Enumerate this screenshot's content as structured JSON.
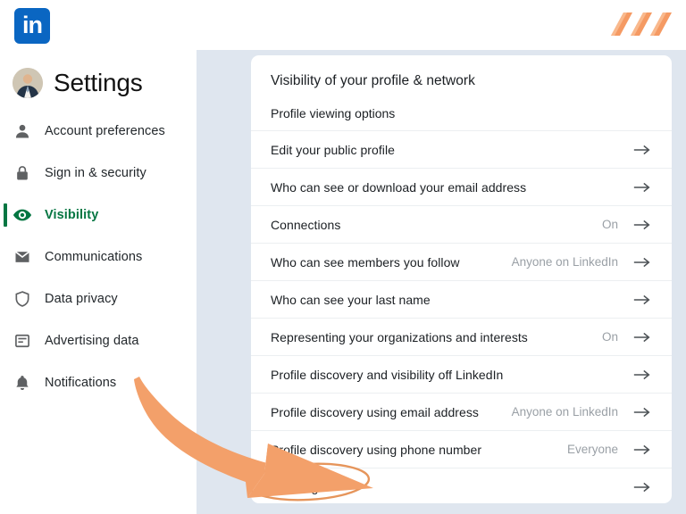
{
  "brand": {
    "logo_text": "in",
    "logo_color": "#0a66c2",
    "accent_color": "#057642",
    "annotation_color": "#f3a06a"
  },
  "sidebar": {
    "title": "Settings",
    "avatar_name": "profile-avatar",
    "items": [
      {
        "label": "Account preferences",
        "icon": "person-icon",
        "active": false
      },
      {
        "label": "Sign in & security",
        "icon": "lock-icon",
        "active": false
      },
      {
        "label": "Visibility",
        "icon": "eye-icon",
        "active": true
      },
      {
        "label": "Communications",
        "icon": "envelope-icon",
        "active": false
      },
      {
        "label": "Data privacy",
        "icon": "shield-icon",
        "active": false
      },
      {
        "label": "Advertising data",
        "icon": "card-icon",
        "active": false
      },
      {
        "label": "Notifications",
        "icon": "bell-icon",
        "active": false
      }
    ]
  },
  "main": {
    "title": "Visibility of your profile & network",
    "section_heading": "Profile viewing options",
    "rows": [
      {
        "label": "Edit your public profile",
        "value": ""
      },
      {
        "label": "Who can see or download your email address",
        "value": ""
      },
      {
        "label": "Connections",
        "value": "On"
      },
      {
        "label": "Who can see members you follow",
        "value": "Anyone on LinkedIn"
      },
      {
        "label": "Who can see your last name",
        "value": ""
      },
      {
        "label": "Representing your organizations and interests",
        "value": "On"
      },
      {
        "label": "Profile discovery and visibility off LinkedIn",
        "value": ""
      },
      {
        "label": "Profile discovery using email address",
        "value": "Anyone on LinkedIn"
      },
      {
        "label": "Profile discovery using phone number",
        "value": "Everyone"
      },
      {
        "label": "Blocking",
        "value": ""
      }
    ]
  },
  "annotation": {
    "highlighted_row_label": "Blocking",
    "shapes": [
      "curved-arrow",
      "ellipse-highlight"
    ]
  }
}
